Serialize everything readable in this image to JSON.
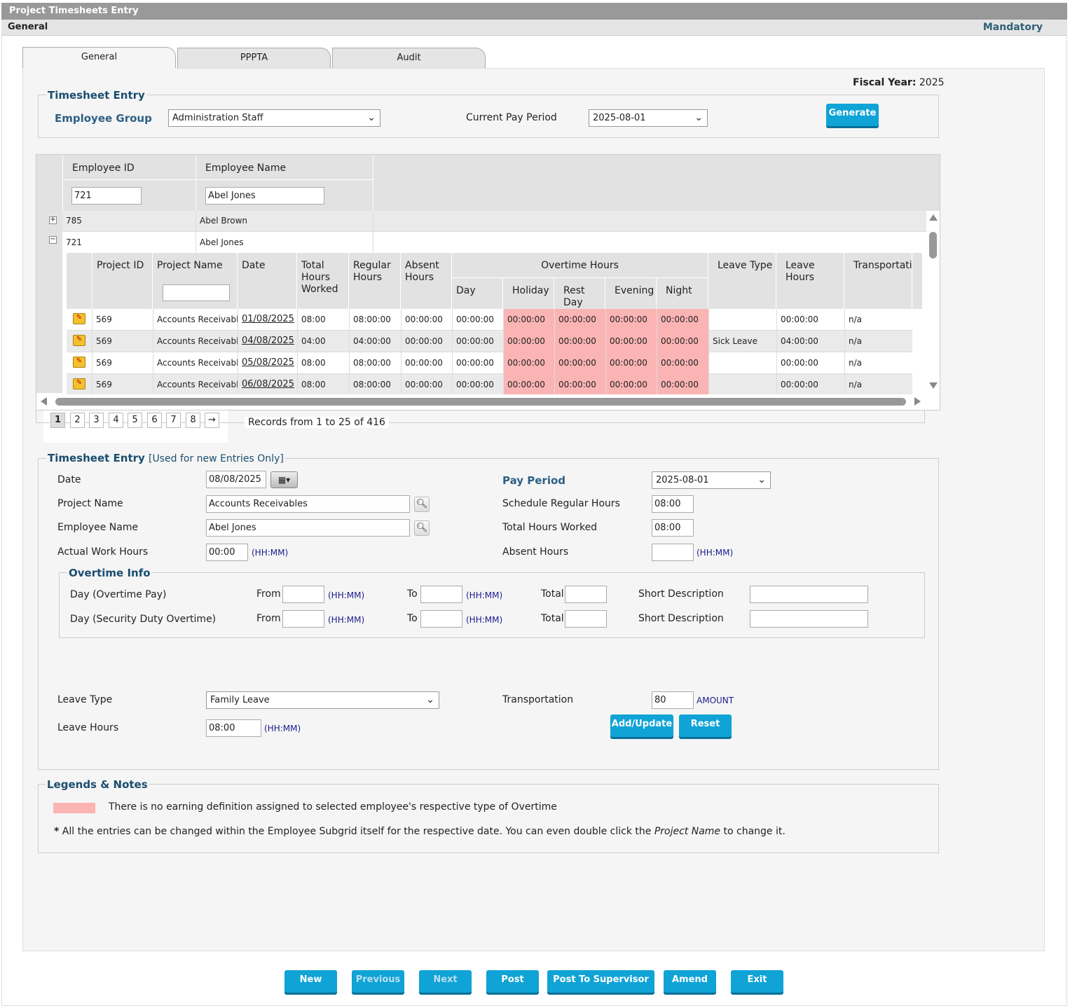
{
  "window": {
    "title": "Project Timesheets Entry",
    "section": "General",
    "mandatory": "Mandatory"
  },
  "tabs": [
    "General",
    "PPPTA",
    "Audit"
  ],
  "fiscal": {
    "label": "Fiscal Year:",
    "value": "2025"
  },
  "entry": {
    "legend": "Timesheet Entry",
    "group_label": "Employee Group",
    "group_value": "Administration Staff",
    "period_label": "Current Pay Period",
    "period_value": "2025-08-01",
    "generate": "Generate"
  },
  "grid": {
    "headers": {
      "emp_id": "Employee ID",
      "emp_name": "Employee Name"
    },
    "filters": {
      "emp_id": "721",
      "emp_name": "Abel Jones"
    },
    "employees": [
      {
        "sign": "+",
        "id": "785",
        "name": "Abel Brown"
      },
      {
        "sign": "−",
        "id": "721",
        "name": "Abel Jones"
      }
    ],
    "sub_headers": {
      "project_id": "Project ID",
      "project_name": "Project Name",
      "date": "Date",
      "total": "Total Hours Worked",
      "regular": "Regular Hours",
      "absent": "Absent Hours",
      "overtime": "Overtime Hours",
      "day": "Day",
      "holiday": "Holiday",
      "rest": "Rest Day",
      "evening": "Evening",
      "night": "Night",
      "leave_type": "Leave Type",
      "leave_hours": "Leave Hours",
      "transport": "Transportation"
    },
    "rows": [
      {
        "pid": "569",
        "pname": "Accounts Receivable",
        "date": "01/08/2025",
        "total": "08:00",
        "regular": "08:00:00",
        "absent": "00:00:00",
        "day": "00:00:00",
        "holiday": "00:00:00",
        "rest": "00:00:00",
        "evening": "00:00:00",
        "night": "00:00:00",
        "ltype": "",
        "lhours": "00:00:00",
        "trans": "n/a"
      },
      {
        "pid": "569",
        "pname": "Accounts Receivable",
        "date": "04/08/2025",
        "total": "04:00",
        "regular": "04:00:00",
        "absent": "00:00:00",
        "day": "00:00:00",
        "holiday": "00:00:00",
        "rest": "00:00:00",
        "evening": "00:00:00",
        "night": "00:00:00",
        "ltype": "Sick Leave",
        "lhours": "04:00:00",
        "trans": "n/a"
      },
      {
        "pid": "569",
        "pname": "Accounts Receivable",
        "date": "05/08/2025",
        "total": "08:00",
        "regular": "08:00:00",
        "absent": "00:00:00",
        "day": "00:00:00",
        "holiday": "00:00:00",
        "rest": "00:00:00",
        "evening": "00:00:00",
        "night": "00:00:00",
        "ltype": "",
        "lhours": "00:00:00",
        "trans": "n/a"
      },
      {
        "pid": "569",
        "pname": "Accounts Receivable",
        "date": "06/08/2025",
        "total": "08:00",
        "regular": "08:00:00",
        "absent": "00:00:00",
        "day": "00:00:00",
        "holiday": "00:00:00",
        "rest": "00:00:00",
        "evening": "00:00:00",
        "night": "00:00:00",
        "ltype": "",
        "lhours": "00:00:00",
        "trans": "n/a"
      }
    ]
  },
  "pager": {
    "pages": [
      "1",
      "2",
      "3",
      "4",
      "5",
      "6",
      "7",
      "8",
      "→"
    ],
    "records": "Records from 1 to 25 of 416"
  },
  "form": {
    "legend": "Timesheet Entry",
    "legend_note": "[Used for new Entries Only]",
    "date_label": "Date",
    "date_value": "08/08/2025",
    "project_label": "Project Name",
    "project_value": "Accounts Receivables",
    "employee_label": "Employee Name",
    "employee_value": "Abel Jones",
    "actual_label": "Actual Work Hours",
    "actual_value": "00:00",
    "hhmm": "(HH:MM)",
    "payperiod_label": "Pay Period",
    "payperiod_value": "2025-08-01",
    "schedule_label": "Schedule Regular Hours",
    "schedule_value": "08:00",
    "total_label": "Total Hours Worked",
    "total_value": "08:00",
    "absent_label": "Absent Hours",
    "absent_value": "",
    "ot_legend": "Overtime Info",
    "ot_row1": "Day (Overtime Pay)",
    "ot_row2": "Day (Security Duty Overtime)",
    "from": "From",
    "to": "To",
    "total": "Total",
    "short_desc": "Short Description",
    "leave_type_label": "Leave Type",
    "leave_type_value": "Family Leave",
    "leave_hours_label": "Leave Hours",
    "leave_hours_value": "08:00",
    "transport_label": "Transportation",
    "transport_value": "80",
    "amount": "AMOUNT",
    "add_update": "Add/Update",
    "reset": "Reset"
  },
  "legends": {
    "legend": "Legends & Notes",
    "pink_note": "There is no earning definition assigned to selected employee's respective type of Overtime",
    "star": "*",
    "note_pre": "All the entries can be changed within the Employee Subgrid itself for the respective date. You can even double click the",
    "note_em": "Project Name",
    "note_post": "to change it.",
    "pink_color": "#fbb4b4"
  },
  "footer": {
    "new": "New",
    "previous": "Previous",
    "next": "Next",
    "post": "Post",
    "post_sup": "Post To Supervisor",
    "amend": "Amend",
    "exit": "Exit"
  }
}
